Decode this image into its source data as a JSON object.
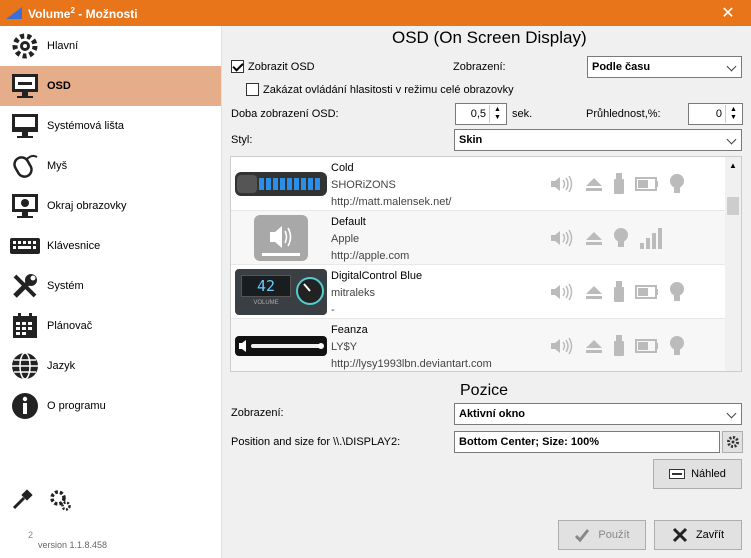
{
  "window": {
    "title_main": "Volume",
    "title_sup": "2",
    "title_rest": " - Možnosti",
    "close_symbol": "✕"
  },
  "sidebar": {
    "items": [
      {
        "label": "Hlavní",
        "icon": "gears-icon"
      },
      {
        "label": "OSD",
        "icon": "monitor-icon"
      },
      {
        "label": "Systémová lišta",
        "icon": "taskbar-icon"
      },
      {
        "label": "Myš",
        "icon": "mouse-icon"
      },
      {
        "label": "Okraj obrazovky",
        "icon": "screen-edge-icon"
      },
      {
        "label": "Klávesnice",
        "icon": "keyboard-icon"
      },
      {
        "label": "Systém",
        "icon": "tools-icon"
      },
      {
        "label": "Plánovač",
        "icon": "calendar-icon"
      },
      {
        "label": "Jazyk",
        "icon": "globe-icon"
      },
      {
        "label": "O programu",
        "icon": "info-icon"
      }
    ],
    "active_index": 1,
    "version_sup": "2",
    "version": "version 1.1.8.458"
  },
  "osd": {
    "heading": "OSD (On Screen Display)",
    "show_osd_label": "Zobrazit OSD",
    "show_osd_checked": true,
    "display_label": "Zobrazení:",
    "display_value": "Podle času",
    "disable_fullscreen_label": "Zakázat ovládání hlasitosti v režimu celé obrazovky",
    "disable_fullscreen_checked": false,
    "duration_label": "Doba zobrazení OSD:",
    "duration_value": "0,5",
    "duration_unit": "sek.",
    "transparency_label": "Průhlednost,%:",
    "transparency_value": "0",
    "style_label": "Styl:",
    "style_value": "Skin"
  },
  "skins": [
    {
      "name": "Cold",
      "author": "SHORiZONS",
      "url": "http://matt.malensek.net/"
    },
    {
      "name": "Default",
      "author": "Apple",
      "url": "http://apple.com"
    },
    {
      "name": "DigitalControl Blue",
      "author": "mitraleks",
      "url": "-",
      "preview_number": "42",
      "preview_label": "VOLUME"
    },
    {
      "name": "Feanza",
      "author": "LY$Y",
      "url": "http://lysy1993lbn.deviantart.com"
    }
  ],
  "position": {
    "heading": "Pozice",
    "display_label": "Zobrazení:",
    "display_value": "Aktivní okno",
    "size_label": "Position and size for \\\\.\\DISPLAY2:",
    "size_value": "Bottom Center; Size: 100%"
  },
  "buttons": {
    "preview": "Náhled",
    "apply": "Použít",
    "close": "Zavřít"
  },
  "colors": {
    "accent": "#e8751a",
    "active_item": "#e6ad8a"
  }
}
